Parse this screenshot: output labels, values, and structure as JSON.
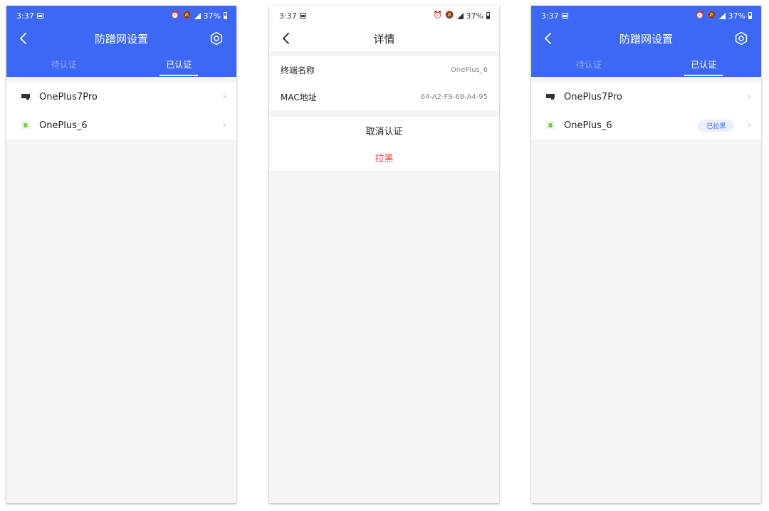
{
  "status_bar": {
    "time": "3:37",
    "battery": "37%"
  },
  "screen1": {
    "title": "防蹭网设置",
    "tabs": [
      {
        "label": "待认证"
      },
      {
        "label": "已认证"
      }
    ],
    "devices": [
      {
        "name": "OnePlus7Pro"
      },
      {
        "name": "OnePlus_6"
      }
    ]
  },
  "screen2": {
    "title": "详情",
    "fields": [
      {
        "label": "终端名称",
        "value": "OnePlus_6"
      },
      {
        "label": "MAC地址",
        "value": "64-A2-F9-68-A4-95"
      }
    ],
    "actions": {
      "cancel_auth": "取消认证",
      "blacklist": "拉黑"
    }
  },
  "screen3": {
    "title": "防蹭网设置",
    "tabs": [
      {
        "label": "待认证"
      },
      {
        "label": "已认证"
      }
    ],
    "devices": [
      {
        "name": "OnePlus7Pro"
      },
      {
        "name": "OnePlus_6",
        "badge": "已拉黑"
      }
    ]
  },
  "icons": {
    "back": "chevron-left-icon",
    "settings": "gear-icon",
    "device_tablet": "monitor-icon",
    "device_android": "android-icon",
    "row_arrow": "chevron-right-icon"
  },
  "colors": {
    "primary": "#3d68f5",
    "danger": "#ef3b3b",
    "page_bg": "#f3f4f6"
  }
}
